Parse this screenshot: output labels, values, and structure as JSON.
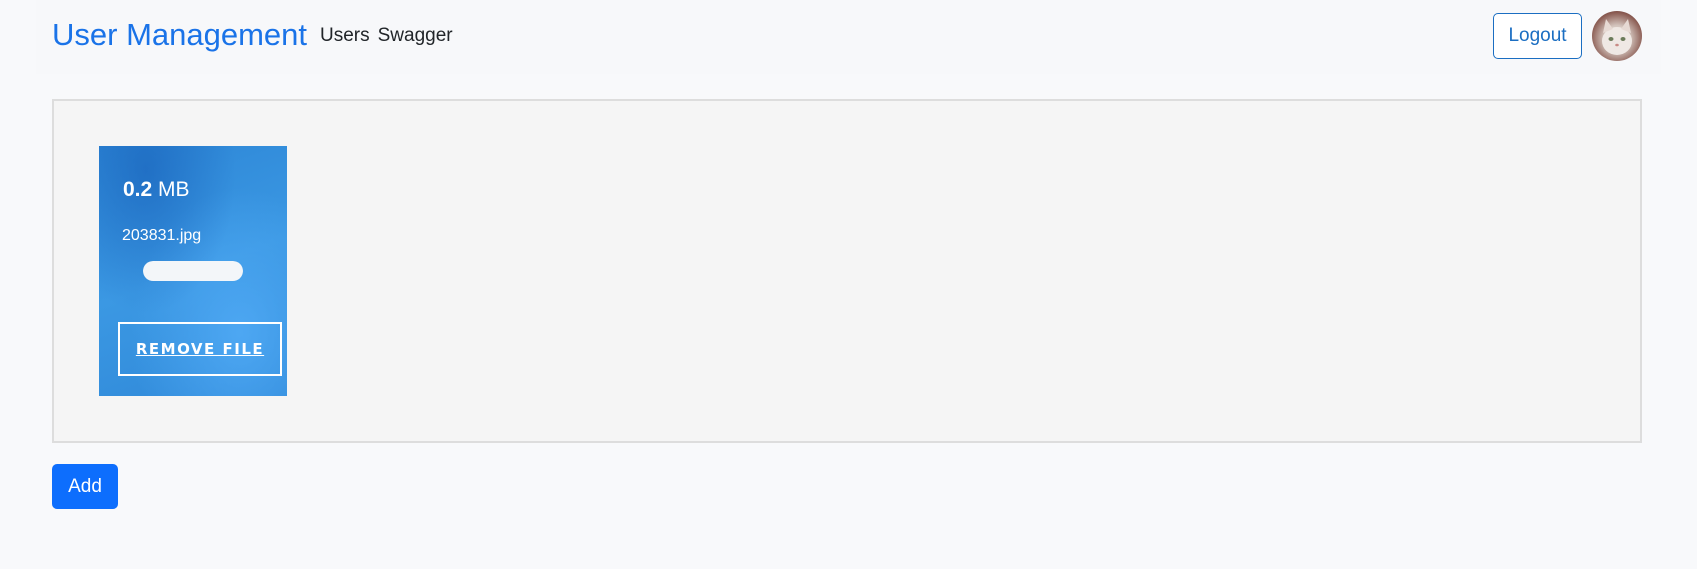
{
  "header": {
    "brand": "User Management",
    "nav": [
      "Users",
      "Swagger"
    ],
    "logout_label": "Logout",
    "avatar": "user-avatar-cat-photo"
  },
  "upload": {
    "files": [
      {
        "size_value": "0.2",
        "size_unit": "MB",
        "name": "203831.jpg",
        "progress_percent": 100,
        "remove_label": "Remove file"
      }
    ]
  },
  "actions": {
    "add_label": "Add"
  },
  "colors": {
    "brand": "#1a73e8",
    "primary": "#0d6efd",
    "file_card": "#3b98e3",
    "logout_border": "#1b6ec2"
  }
}
